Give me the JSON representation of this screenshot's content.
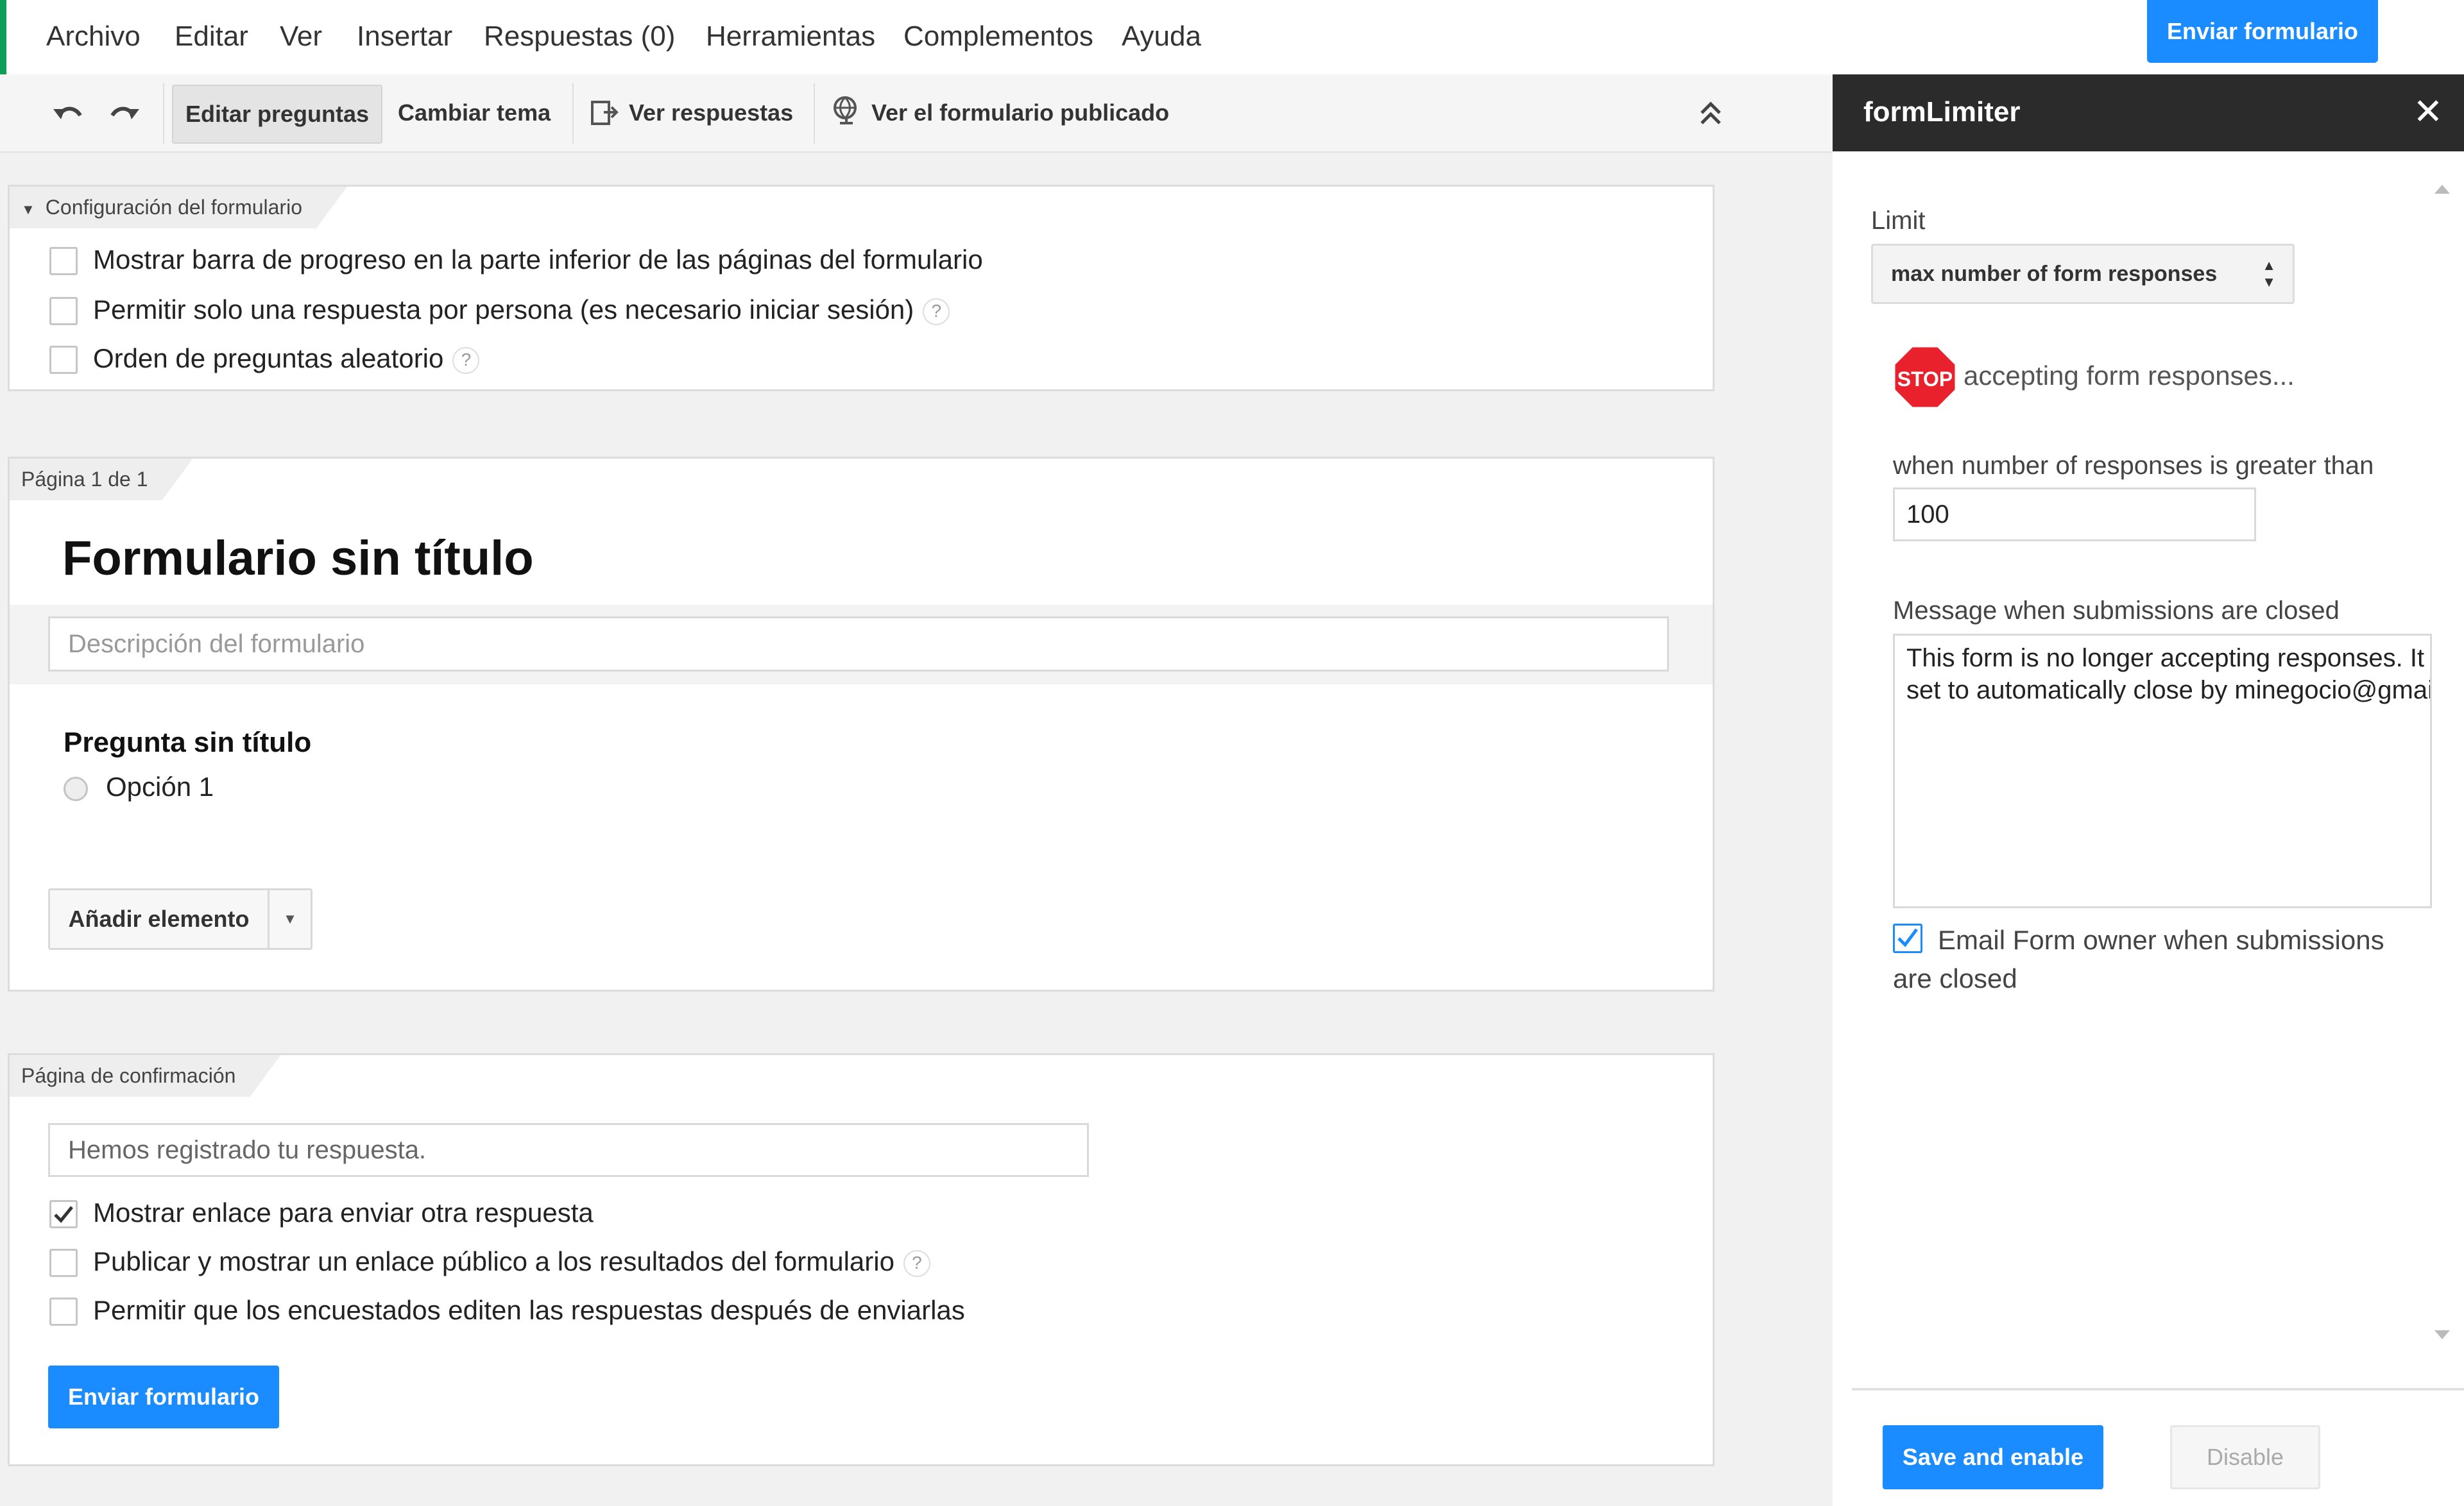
{
  "menu": {
    "items": [
      "Archivo",
      "Editar",
      "Ver",
      "Insertar",
      "Respuestas (0)",
      "Herramientas",
      "Complementos",
      "Ayuda"
    ],
    "send_button": "Enviar formulario"
  },
  "toolbar": {
    "undo_icon": "undo-icon",
    "redo_icon": "redo-icon",
    "edit_questions": "Editar preguntas",
    "change_theme": "Cambiar tema",
    "view_responses": "Ver respuestas",
    "view_published": "Ver el formulario publicado"
  },
  "settings": {
    "tab": "Configuración del formulario",
    "options": [
      {
        "label": "Mostrar barra de progreso en la parte inferior de las páginas del formulario",
        "checked": false,
        "help": false
      },
      {
        "label": "Permitir solo una respuesta por persona (es necesario iniciar sesión)",
        "checked": false,
        "help": true
      },
      {
        "label": "Orden de preguntas aleatorio",
        "checked": false,
        "help": true
      }
    ]
  },
  "page": {
    "tab": "Página 1 de 1",
    "form_title": "Formulario sin título",
    "description_placeholder": "Descripción del formulario",
    "question_title": "Pregunta sin título",
    "option_1": "Opción 1",
    "add_item": "Añadir elemento"
  },
  "confirmation": {
    "tab": "Página de confirmación",
    "message_value": "Hemos registrado tu respuesta.",
    "options": [
      {
        "label": "Mostrar enlace para enviar otra respuesta",
        "checked": true,
        "help": false
      },
      {
        "label": "Publicar y mostrar un enlace público a los resultados del formulario",
        "checked": false,
        "help": true
      },
      {
        "label": "Permitir que los encuestados editen las respuestas después de enviarlas",
        "checked": false,
        "help": false
      }
    ],
    "send_button": "Enviar formulario"
  },
  "sidebar": {
    "title": "formLimiter",
    "limit_label": "Limit",
    "limit_select": "max number of form responses",
    "stop_sign_text": "STOP",
    "stop_text": "accepting form responses...",
    "when_label": "when number of responses is greater than",
    "responses_value": "100",
    "message_label": "Message when submissions are closed",
    "message_value": "This form is no longer accepting responses. It has been set to automatically close by minegocio@gmailes.com",
    "email_owner_label": "Email Form owner when submissions are closed",
    "email_owner_checked": true,
    "save_button": "Save and enable",
    "disable_button": "Disable"
  },
  "colors": {
    "accent_blue": "#1a8cff",
    "sidebar_header": "#2b2b2b",
    "google_green": "#0f9d58",
    "stop_red": "#e8212c"
  }
}
